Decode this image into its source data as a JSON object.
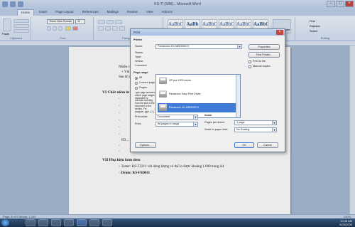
{
  "titlebar": {
    "title": "KS-TI (SIM)... Microsoft Word",
    "minimize": "–",
    "maximize": "□",
    "close": "×"
  },
  "tabs": [
    "Home",
    "Insert",
    "Page Layout",
    "References",
    "Mailings",
    "Review",
    "View",
    "Add-Ins"
  ],
  "ribbon": {
    "groups": [
      "Clipboard",
      "Font",
      "Paragraph",
      "Styles",
      "Editing"
    ],
    "paste_label": "Paste",
    "font_name": "Times New Roman",
    "font_size": "12",
    "styles": [
      {
        "preview": "AaBbC",
        "name": "¶ Normal"
      },
      {
        "preview": "AaBb",
        "name": "Heading 1"
      },
      {
        "preview": "AaBbCc",
        "name": "Heading 2"
      },
      {
        "preview": "AaBbCc",
        "name": "Heading 3"
      },
      {
        "preview": "AaBbCc",
        "name": "Heading 4"
      },
      {
        "preview": "AaBbC",
        "name": "Title"
      }
    ],
    "change_styles": "Change Styles",
    "find": "Find",
    "replace": "Replace",
    "select": "Select"
  },
  "document": {
    "lines": [
      "Nhiều c...",
      "+ Vải 1 ...",
      "Sau đó nhì...",
      "VI  Chất niêm in b...",
      "VII  Phụ kiện kèm theo",
      "Tester: KS-T3211   với dòng lượng có thể in được khoảng 1.000 trang A4",
      "Drum: KS-F6D011"
    ],
    "bullets": [
      "-",
      "-",
      "-",
      "-",
      "-",
      "-",
      "FD...",
      "-",
      "-"
    ]
  },
  "status": {
    "page": "Page: 6 of 6",
    "words": "Words: 1,344",
    "zoom": "100%"
  },
  "taskbar": {
    "time": "10:46 AM",
    "date": "6/25/2009"
  },
  "dialog": {
    "title": "Print",
    "printer_label": "Printer",
    "name_label": "Name:",
    "name_value": "Panasonic KX-MB2000CX",
    "properties": "Properties",
    "find_printer": "Find Printer...",
    "status_label": "Status:",
    "type_label": "Type:",
    "where_label": "Where:",
    "comment_label": "Comment:",
    "print_to_file": "Print to file",
    "manual_duplex": "Manual duplex",
    "printers": [
      "HP psc 1200 series",
      "Panasonic Easy Print Driver",
      "Panasonic KX-MB2000CX"
    ],
    "page_range": "Page range",
    "all": "All",
    "current_page": "Current page",
    "pages": "Pages:",
    "pages_help": "Type page numbers and/or page ranges separated by commas counting from the start of the document or the section. For example, type 1, 3, 5–12 or p1s1, p1s2, p1s3–p8s3",
    "copies": "Copies",
    "print_what_label": "Print what:",
    "print_what_value": "Document",
    "print_label": "Print:",
    "print_value": "All pages in range",
    "zoom_label": "Zoom",
    "pages_per_sheet_label": "Pages per sheet:",
    "pages_per_sheet_value": "1 page",
    "scale_label": "Scale to paper size:",
    "scale_value": "No Scaling",
    "options": "Options...",
    "ok": "OK",
    "cancel": "Cancel"
  }
}
